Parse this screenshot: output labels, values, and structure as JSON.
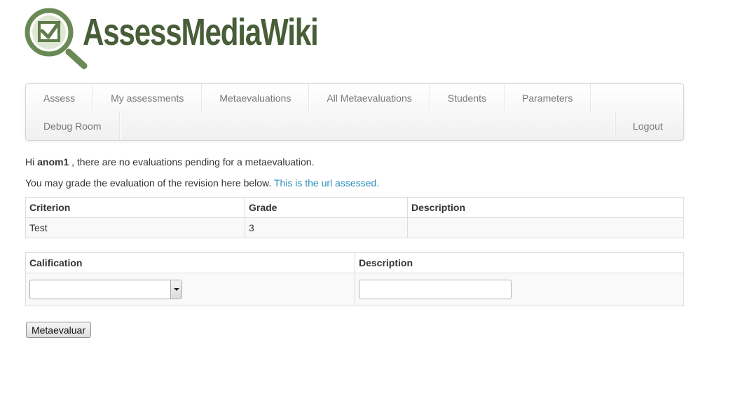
{
  "brand": {
    "name": "AssessMediaWiki",
    "color": "#475e38",
    "icon": "magnifier-checkbox-icon"
  },
  "nav": {
    "row1": [
      "Assess",
      "My assessments",
      "Metaevaluations",
      "All Metaevaluations",
      "Students",
      "Parameters"
    ],
    "row2": [
      "Debug Room"
    ],
    "logout": "Logout"
  },
  "message": {
    "hi": "Hi",
    "user": "anom1",
    "pending": ", there are no evaluations pending for a metaevaluation.",
    "grade_intro": "You may grade the evaluation of the revision here below.",
    "url_link": "This is the url assessed."
  },
  "criteria_table": {
    "headers": [
      "Criterion",
      "Grade",
      "Description"
    ],
    "rows": [
      [
        "Test",
        "3",
        ""
      ]
    ]
  },
  "form_table": {
    "headers": [
      "Calification",
      "Description"
    ],
    "calification_value": "",
    "description_value": ""
  },
  "submit_label": "Metaevaluar",
  "colors": {
    "link": "#2a8fbd",
    "text": "#333333"
  }
}
